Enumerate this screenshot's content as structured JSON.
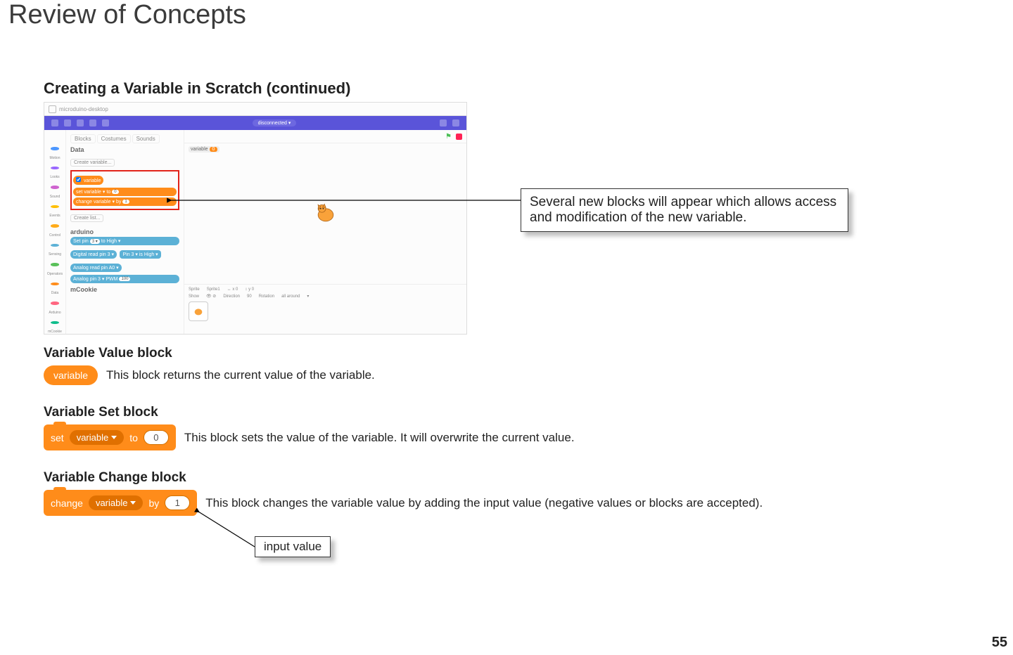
{
  "page": {
    "title": "Review of Concepts",
    "number": "55"
  },
  "section": {
    "heading": "Creating a Variable in Scratch (continued)"
  },
  "window": {
    "tab": "microduino-desktop",
    "connection": "disconnected",
    "tabs": {
      "blocks": "Blocks",
      "costumes": "Costumes",
      "sounds": "Sounds"
    },
    "category": "Data",
    "createBtn": "Create variable...",
    "variableName": "variable",
    "setText": "set",
    "toText": "to",
    "setVal": "0",
    "changeText": "change",
    "byText": "by",
    "changeVal": "1",
    "createList": "Create list...",
    "arduinoHead": "arduino",
    "mcookieHead": "mCookie",
    "pin": "Set pin",
    "high": "to High ▾",
    "dread": "Digital read pin",
    "three": "3 ▾",
    "pinIs": "Pin 3 ▾ is High ▾",
    "aread": "Analog read pin  A0 ▾",
    "apin": "Analog pin  3 ▾  PWM",
    "hundred": "100",
    "spritePane": {
      "sprite": "Sprite",
      "name": "Sprite1",
      "x": "x",
      "xv": "0",
      "y": "y",
      "yv": "0",
      "show": "Show",
      "direction": "Direction",
      "dval": "90",
      "rotation": "Rotation",
      "rval": "all around"
    },
    "varMonitor": {
      "label": "variable",
      "value": "0"
    },
    "palette": {
      "motion": "Motion",
      "looks": "Looks",
      "sound": "Sound",
      "events": "Events",
      "control": "Control",
      "sensing": "Sensing",
      "operators": "Operators",
      "data": "Data",
      "arduino": "Arduino",
      "mcookie": "mCookie"
    }
  },
  "callouts": {
    "newBlocks": "Several new blocks will appear which allows access and modification of the new variable.",
    "inputValue": "input value"
  },
  "valueBlock": {
    "heading": "Variable Value block",
    "label": "variable",
    "desc": "This block returns the current value of the variable."
  },
  "setBlock": {
    "heading": "Variable Set block",
    "set": "set",
    "var": "variable",
    "to": "to",
    "val": "0",
    "desc": "This block sets the value of the variable. It will overwrite the current value."
  },
  "changeBlock": {
    "heading": "Variable Change block",
    "change": "change",
    "var": "variable",
    "by": "by",
    "val": "1",
    "desc": "This block changes the variable value by adding the input value (negative values or blocks are accepted)."
  }
}
